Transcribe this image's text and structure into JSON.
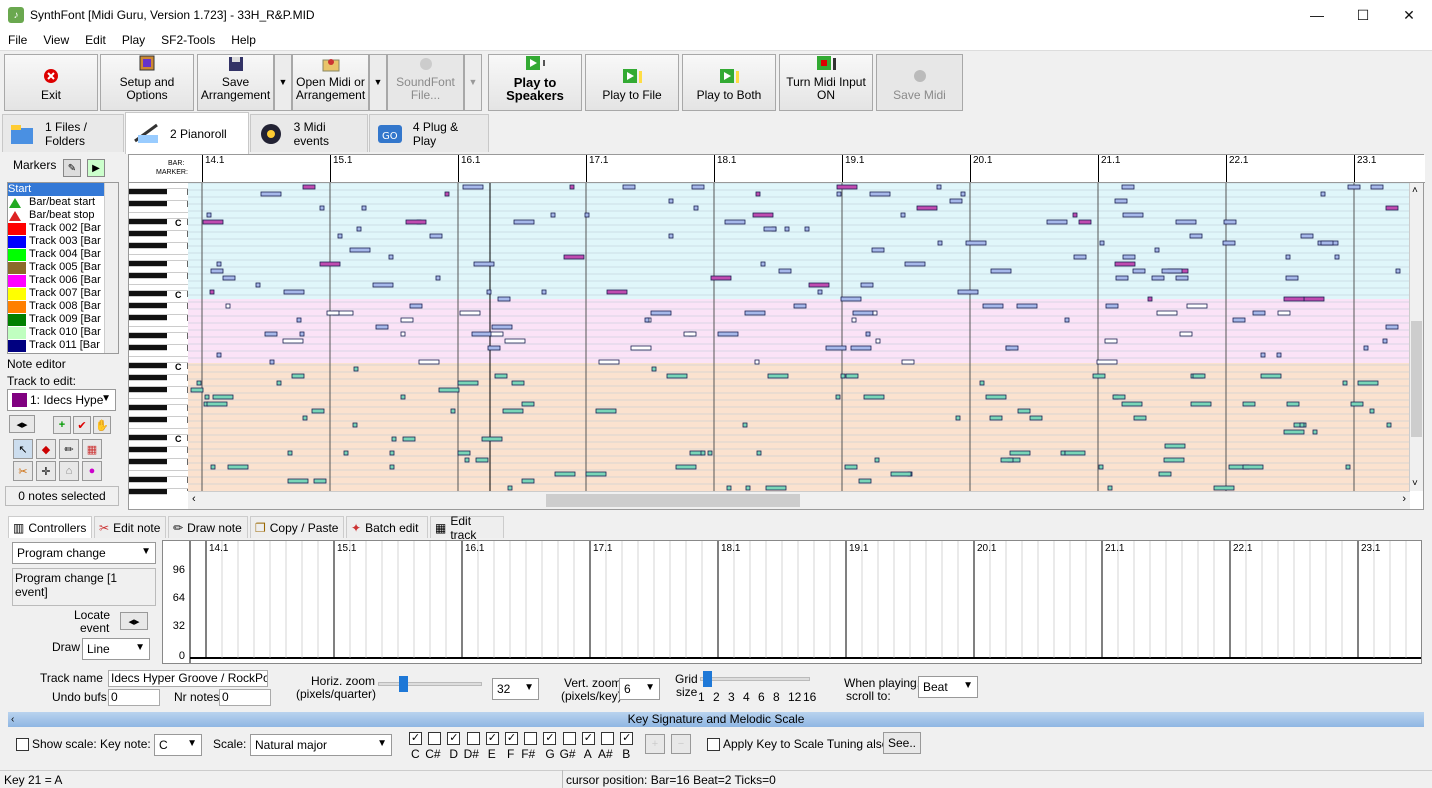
{
  "window": {
    "title": "SynthFont [Midi Guru, Version 1.723] - 33H_R&P.MID",
    "minimize": "—",
    "maximize": "☐",
    "close": "✕"
  },
  "menu": [
    "File",
    "View",
    "Edit",
    "Play",
    "SF2-Tools",
    "Help"
  ],
  "toolbar": {
    "exit": "Exit",
    "setup": "Setup and Options",
    "save1": "Save",
    "save2": "Arrangement",
    "open1": "Open Midi or",
    "open2": "Arrangement",
    "sf1": "SoundFont",
    "sf2": "File...",
    "playspk1": "Play to",
    "playspk2": "Speakers",
    "playfile": "Play to File",
    "playboth": "Play to Both",
    "midiin": "Turn Midi Input ON",
    "savemidi": "Save Midi"
  },
  "tabs": [
    "1 Files / Folders",
    "2 Pianoroll",
    "3 Midi events",
    "4 Plug & Play"
  ],
  "left": {
    "markers": "Markers",
    "note_editor": "Note editor",
    "track_to_edit": "Track to edit:",
    "track_selected": "1: Idecs Hype",
    "notes_selected": "0 notes selected",
    "tracks": [
      {
        "name": "Start",
        "color": "#3378d6",
        "selected": true
      },
      {
        "name": "Bar/beat start",
        "color": "tri-green"
      },
      {
        "name": "Bar/beat stop",
        "color": "tri-red"
      },
      {
        "name": "Track 002 [Bar",
        "color": "#ff0000"
      },
      {
        "name": "Track 003 [Bar",
        "color": "#0000ff"
      },
      {
        "name": "Track 004 [Bar",
        "color": "#00ff00"
      },
      {
        "name": "Track 005 [Bar",
        "color": "#8b6b2a"
      },
      {
        "name": "Track 006 [Bar",
        "color": "#ff00ff"
      },
      {
        "name": "Track 007 [Bar",
        "color": "#ffff00"
      },
      {
        "name": "Track 008 [Bar",
        "color": "#ff8000"
      },
      {
        "name": "Track 009 [Bar",
        "color": "#008000"
      },
      {
        "name": "Track 010 [Bar",
        "color": "#c0ffc0"
      },
      {
        "name": "Track 011 [Bar",
        "color": "#000080"
      }
    ]
  },
  "pianoroll": {
    "bar_label": "BAR:",
    "marker_label": "MARKER:",
    "bars": [
      "14.1",
      "15.1",
      "16.1",
      "17.1",
      "18.1",
      "19.1",
      "20.1",
      "21.1",
      "22.1",
      "23.1"
    ],
    "key_c": "C"
  },
  "ctrltabs": [
    "Controllers",
    "Edit note",
    "Draw note",
    "Copy / Paste",
    "Batch edit",
    "Edit track"
  ],
  "ctrl": {
    "type": "Program change",
    "info": "Program change [1 event]",
    "locate1": "Locate",
    "locate2": "event",
    "draw": "Draw",
    "draw_mode": "Line",
    "yticks": [
      "96",
      "64",
      "32",
      "0"
    ]
  },
  "bottom": {
    "track_name_lbl": "Track name",
    "track_name": "Idecs Hyper Groove / RockPop",
    "undo_lbl": "Undo bufs",
    "undo": "0",
    "nrnotes_lbl": "Nr notes",
    "nrnotes": "0",
    "hzoom1": "Horiz. zoom",
    "hzoom2": "(pixels/quarter)",
    "hzoom_val": "32",
    "vzoom1": "Vert. zoom",
    "vzoom2": "(pixels/key)",
    "vzoom_val": "6",
    "grid1": "Grid",
    "grid2": "size",
    "grid_ticks": [
      "1",
      "2",
      "3",
      "4",
      "6",
      "8",
      "12",
      "16"
    ],
    "playing1": "When playing,",
    "playing2": "scroll to:",
    "scroll_to": "Beat"
  },
  "keysig": {
    "title": "Key Signature and Melodic Scale",
    "show_scale": "Show scale:",
    "key_note_lbl": "Key note:",
    "key_note": "C",
    "scale_lbl": "Scale:",
    "scale": "Natural major",
    "notes": [
      {
        "n": "C",
        "on": true
      },
      {
        "n": "C#",
        "on": false
      },
      {
        "n": "D",
        "on": true
      },
      {
        "n": "D#",
        "on": false
      },
      {
        "n": "E",
        "on": true
      },
      {
        "n": "F",
        "on": true
      },
      {
        "n": "F#",
        "on": false
      },
      {
        "n": "G",
        "on": true
      },
      {
        "n": "G#",
        "on": false
      },
      {
        "n": "A",
        "on": true
      },
      {
        "n": "A#",
        "on": false
      },
      {
        "n": "B",
        "on": true
      }
    ],
    "apply": "Apply Key to Scale Tuning also",
    "see": "See.."
  },
  "status": {
    "left": "Key 21 = A",
    "right": "cursor position: Bar=16 Beat=2 Ticks=0"
  }
}
